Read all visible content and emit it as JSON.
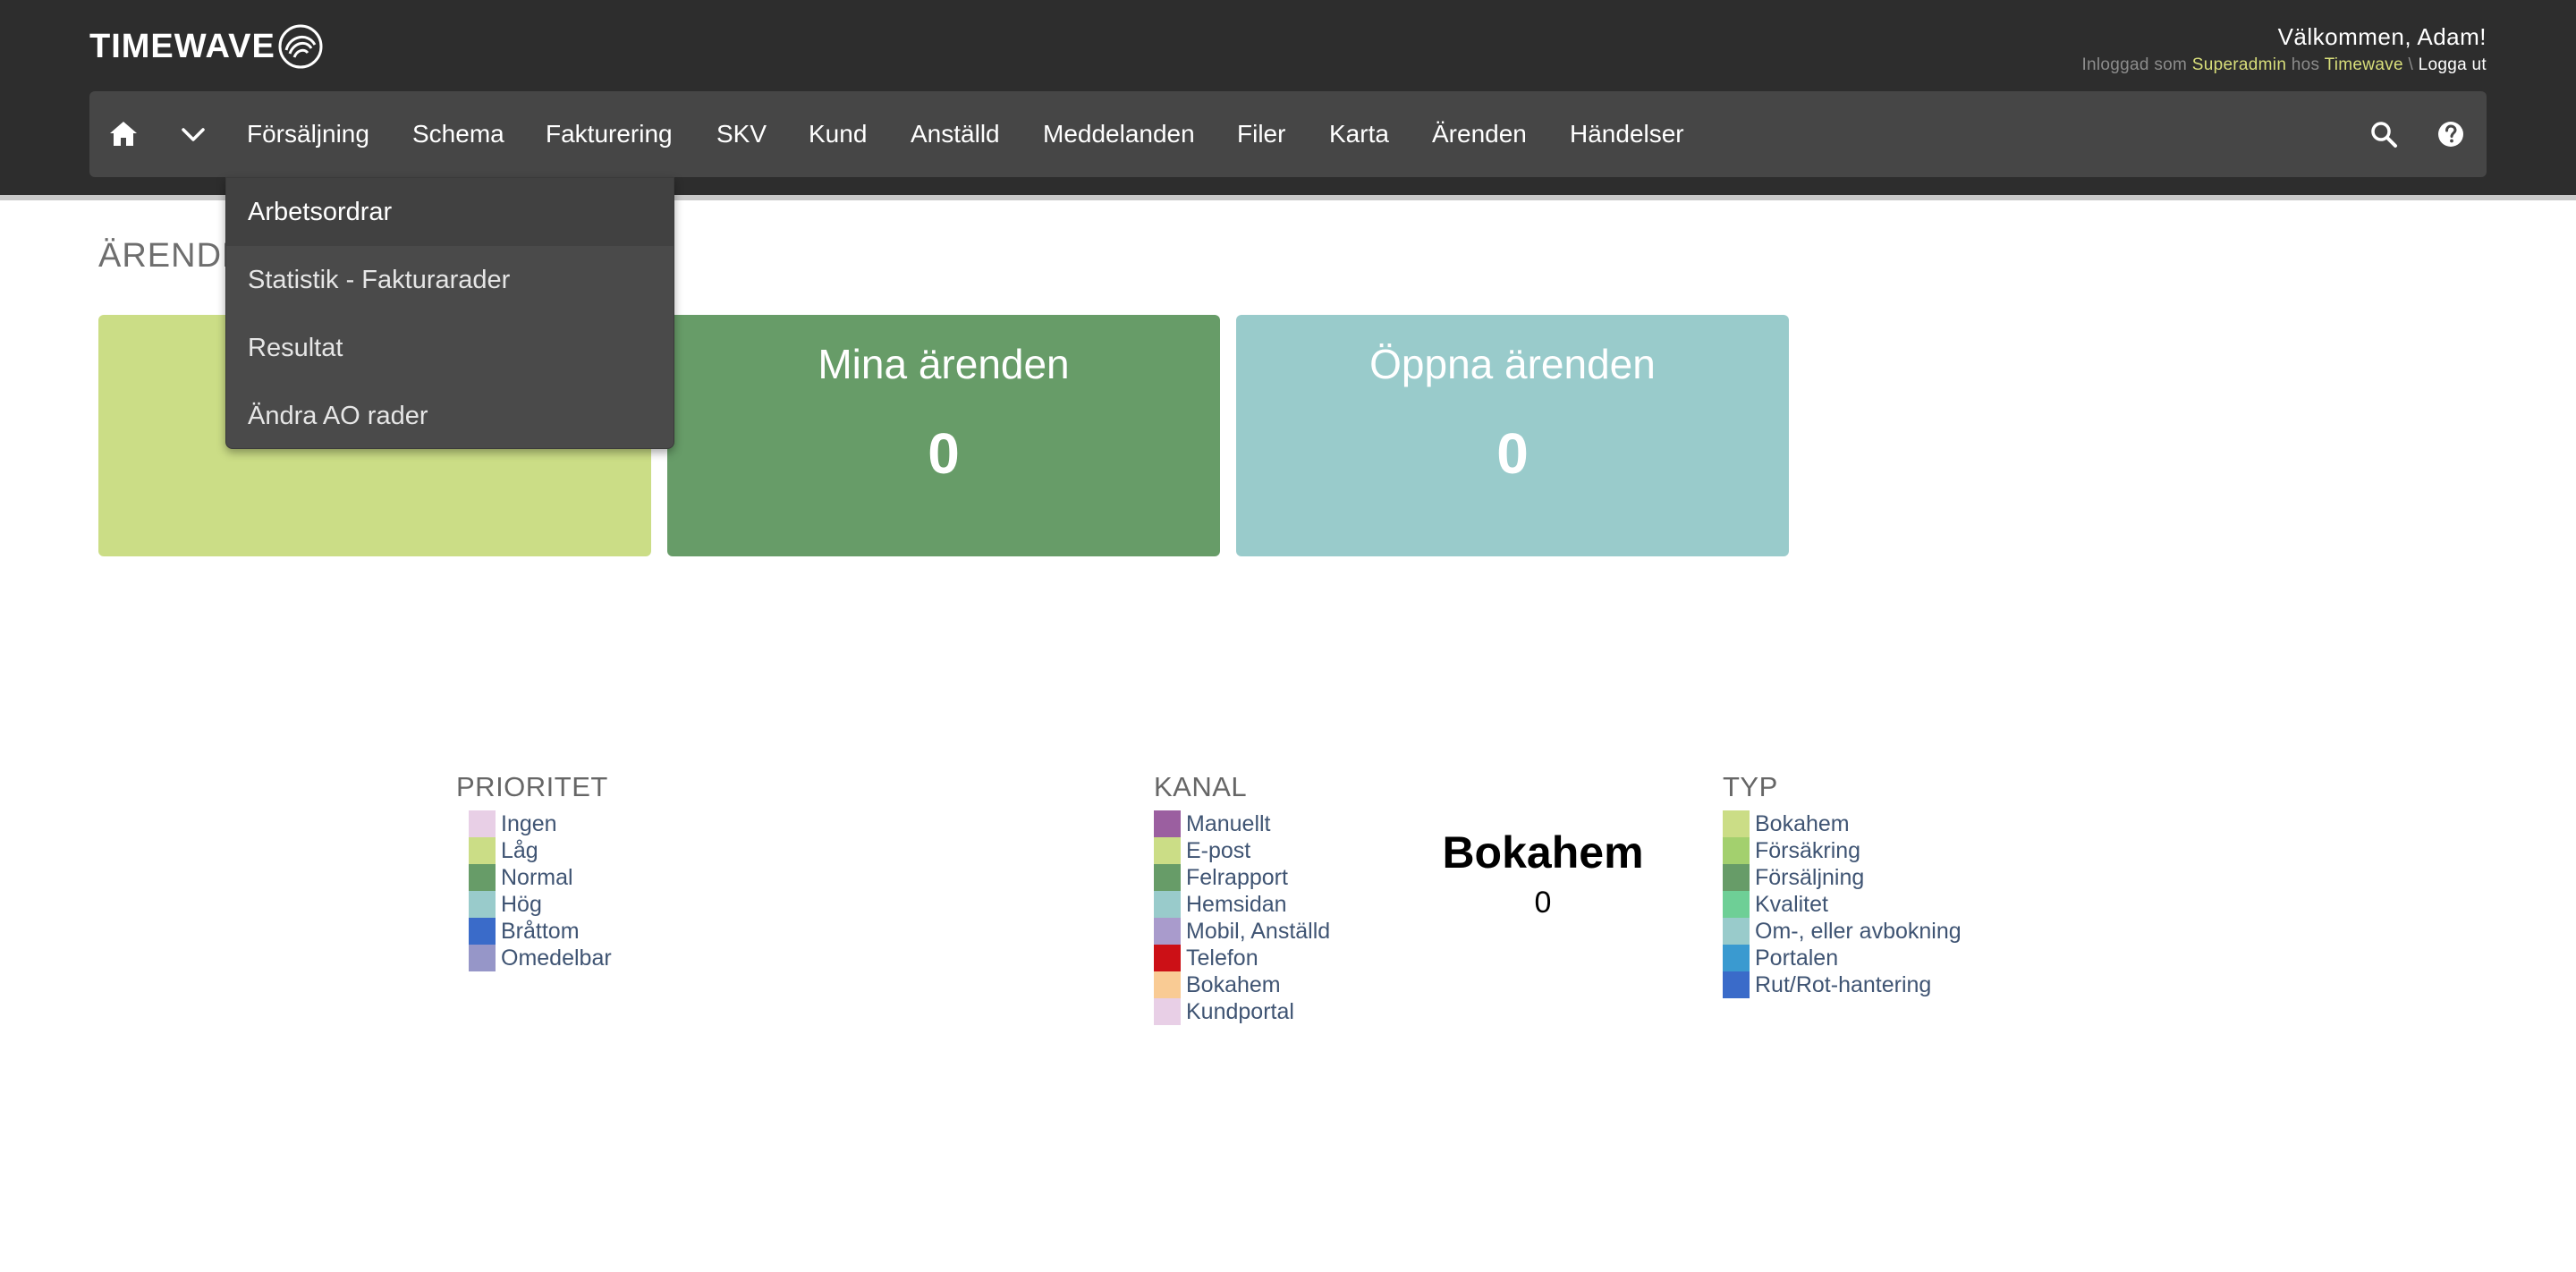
{
  "header": {
    "logo_text": "TIMEWAVE",
    "welcome": "Välkommen, Adam!",
    "login_prefix": "Inloggad som",
    "role": "Superadmin",
    "at": "hos",
    "company": "Timewave",
    "separator": "\\",
    "logout": "Logga ut"
  },
  "nav": {
    "home_icon": "home-icon",
    "chevron_icon": "chevron-down-icon",
    "items": [
      {
        "label": "Försäljning"
      },
      {
        "label": "Schema"
      },
      {
        "label": "Fakturering"
      },
      {
        "label": "SKV"
      },
      {
        "label": "Kund"
      },
      {
        "label": "Anställd"
      },
      {
        "label": "Meddelanden"
      },
      {
        "label": "Filer"
      },
      {
        "label": "Karta"
      },
      {
        "label": "Ärenden"
      },
      {
        "label": "Händelser"
      }
    ],
    "search_icon": "search-icon",
    "help_icon": "help-icon"
  },
  "dropdown": {
    "items": [
      {
        "label": "Arbetsordrar"
      },
      {
        "label": "Statistik - Fakturarader"
      },
      {
        "label": "Resultat"
      },
      {
        "label": "Ändra AO rader"
      }
    ]
  },
  "page": {
    "title": "ÄRENDE"
  },
  "cards": [
    {
      "title": "",
      "value": "",
      "color": "#cbdd86"
    },
    {
      "title": "Mina ärenden",
      "value": "0",
      "color": "#679c68"
    },
    {
      "title": "Öppna ärenden",
      "value": "0",
      "color": "#99cbcb"
    }
  ],
  "legends": {
    "prioritet": {
      "title": "PRIORITET",
      "items": [
        {
          "label": "Ingen",
          "color": "#e8cfe6"
        },
        {
          "label": "Låg",
          "color": "#cbdd86"
        },
        {
          "label": "Normal",
          "color": "#679c68"
        },
        {
          "label": "Hög",
          "color": "#99cbcb"
        },
        {
          "label": "Bråttom",
          "color": "#3a6bc9"
        },
        {
          "label": "Omedelbar",
          "color": "#9696c8"
        }
      ]
    },
    "kanal": {
      "title": "KANAL",
      "items": [
        {
          "label": "Manuellt",
          "color": "#9b5fa0"
        },
        {
          "label": "E-post",
          "color": "#cbdd86"
        },
        {
          "label": "Felrapport",
          "color": "#679c68"
        },
        {
          "label": "Hemsidan",
          "color": "#99cbcb"
        },
        {
          "label": "Mobil, Anställd",
          "color": "#a99bcc"
        },
        {
          "label": "Telefon",
          "color": "#cc1016"
        },
        {
          "label": "Bokahem",
          "color": "#f9cb94"
        },
        {
          "label": "Kundportal",
          "color": "#e8cfe6"
        }
      ]
    },
    "typ": {
      "title": "TYP",
      "items": [
        {
          "label": "Bokahem",
          "color": "#cbdd86"
        },
        {
          "label": "Försäkring",
          "color": "#a3d06e"
        },
        {
          "label": "Försäljning",
          "color": "#679c68"
        },
        {
          "label": "Kvalitet",
          "color": "#6ecf96"
        },
        {
          "label": "Om-, eller avbokning",
          "color": "#99cbcb"
        },
        {
          "label": "Portalen",
          "color": "#3a9ad0"
        },
        {
          "label": "Rut/Rot-hantering",
          "color": "#3a6bc9"
        }
      ]
    }
  },
  "center": {
    "title": "Bokahem",
    "value": "0"
  }
}
